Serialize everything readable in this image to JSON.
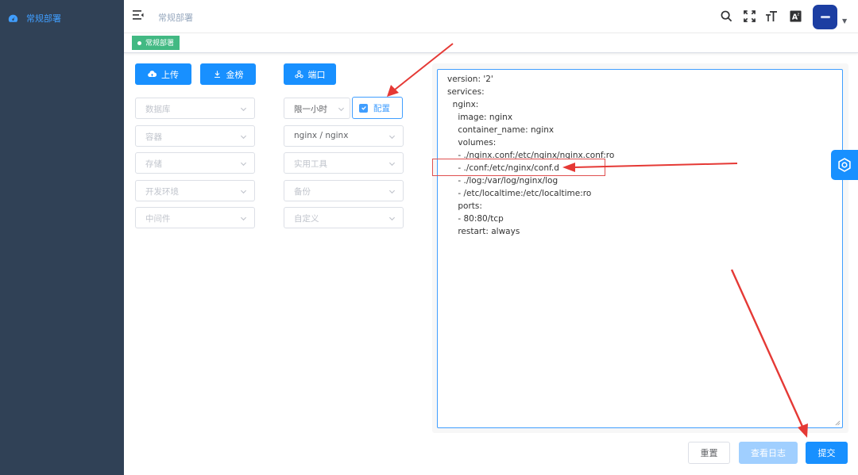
{
  "sidebar": {
    "items": [
      {
        "label": "常规部署",
        "icon": "dashboard-icon"
      }
    ]
  },
  "header": {
    "breadcrumb": "常规部署",
    "icons": [
      "search-icon",
      "fullscreen-icon",
      "font-size-icon",
      "translate-icon"
    ],
    "avatar_icon": "avatar-logo"
  },
  "tags": [
    {
      "label": "常规部署",
      "color": "#42b983"
    }
  ],
  "toolbar": {
    "upload_label": "上传",
    "gold_label": "金榜",
    "port_label": "端口",
    "config_checkbox_label": "配置",
    "config_checked": true
  },
  "selects": {
    "left": [
      {
        "placeholder": "数据库",
        "value": ""
      },
      {
        "placeholder": "容器",
        "value": ""
      },
      {
        "placeholder": "存储",
        "value": ""
      },
      {
        "placeholder": "开发环境",
        "value": ""
      },
      {
        "placeholder": "中间件",
        "value": ""
      }
    ],
    "time": {
      "value": "限一小时"
    },
    "right": [
      {
        "placeholder": "",
        "value": "nginx / nginx"
      },
      {
        "placeholder": "实用工具",
        "value": ""
      },
      {
        "placeholder": "备份",
        "value": ""
      },
      {
        "placeholder": "自定义",
        "value": ""
      }
    ]
  },
  "editor": {
    "lines": [
      "version: '2'",
      "services:",
      "  nginx:",
      "    image: nginx",
      "    container_name: nginx",
      "    volumes:",
      "    - ./nginx.conf:/etc/nginx/nginx.conf:ro",
      "    - ./conf:/etc/nginx/conf.d",
      "    - ./log:/var/log/nginx/log",
      "    - /etc/localtime:/etc/localtime:ro",
      "    ports:",
      "    - 80:80/tcp",
      "    restart: always"
    ]
  },
  "footer": {
    "reset_label": "重置",
    "view_log_label": "查看日志",
    "submit_label": "提交"
  },
  "colors": {
    "accent": "#1890ff",
    "sidebar": "#304156",
    "tag": "#42b983",
    "annotation": "#e53935"
  }
}
